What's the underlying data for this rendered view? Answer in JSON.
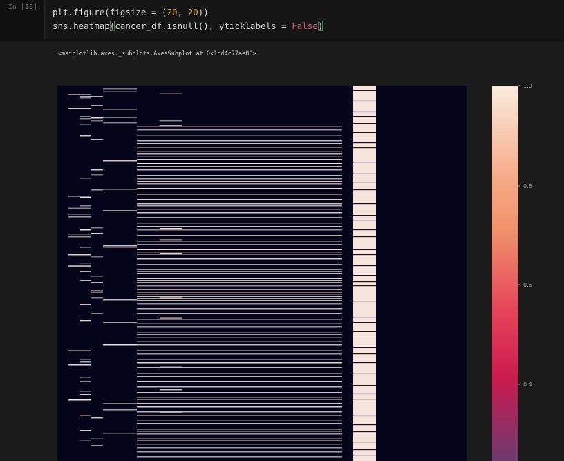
{
  "input_cell": {
    "prompt": "In [18]:",
    "line1_pre": "plt.figure(figsize = (",
    "line1_n1": "20",
    "line1_sep": ", ",
    "line1_n2": "20",
    "line1_post": "))",
    "line2_pre": "sns.heatmap",
    "line2_paren_open": "(",
    "line2_mid": "cancer_df.isnull(), yticklabels = ",
    "line2_kw": "False",
    "line2_paren_close": ")"
  },
  "output_cell": {
    "repr_text": "<matplotlib.axes._subplots.AxesSubplot at 0x1cd4c77ae80>"
  },
  "colors": {
    "heatmap_background": "#04051a",
    "null_line": "#f4e4dc",
    "colorbar_top": "#faebdd",
    "colorbar_mid": "#f0936a",
    "colorbar_low": "#cb1b4f",
    "colorbar_bottom": "#6b3a6e"
  },
  "chart_data": {
    "type": "heatmap",
    "title": "",
    "xlabel": "",
    "ylabel": "",
    "yticklabels": false,
    "colorbar": {
      "ticks": [
        "1.0",
        "0.8",
        "0.6",
        "0.4"
      ],
      "range": [
        0.2,
        1.0
      ]
    },
    "columns": 18,
    "full_null_columns": [
      13
    ],
    "note_values": "cells are 1 (missing) or 0 (present)"
  }
}
